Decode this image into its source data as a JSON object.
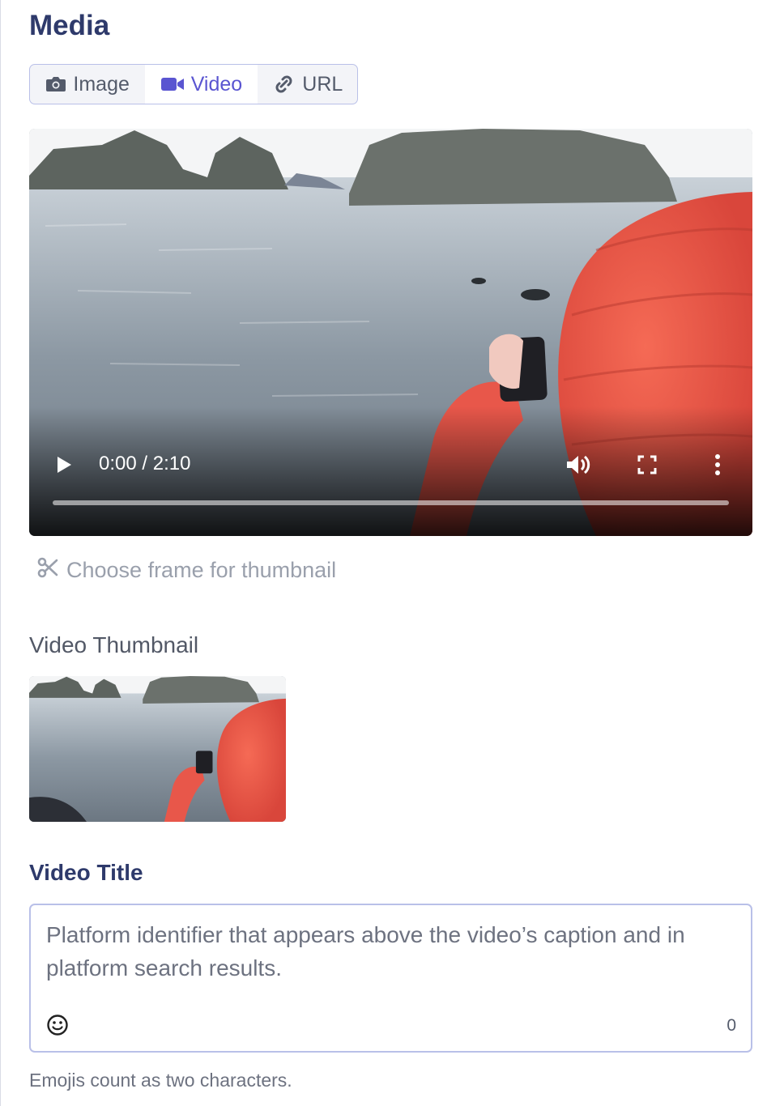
{
  "section": {
    "title": "Media"
  },
  "tabs": [
    {
      "label": "Image",
      "icon": "camera-icon",
      "active": false
    },
    {
      "label": "Video",
      "icon": "video-camera-icon",
      "active": true
    },
    {
      "label": "URL",
      "icon": "link-icon",
      "active": false
    }
  ],
  "colors": {
    "accent": "#5a55d1",
    "title": "#2e3a6b",
    "border": "#b9c0e8"
  },
  "player": {
    "time": "0:00 / 2:10",
    "progress": 0.0
  },
  "thumbnail": {
    "choose_label": "Choose frame for thumbnail",
    "label": "Video Thumbnail"
  },
  "video_title": {
    "label": "Video Title",
    "placeholder": "Platform identifier that appears above the video’s caption and in platform search results.",
    "value": "",
    "char_count": "0",
    "helper": "Emojis count as two characters."
  }
}
